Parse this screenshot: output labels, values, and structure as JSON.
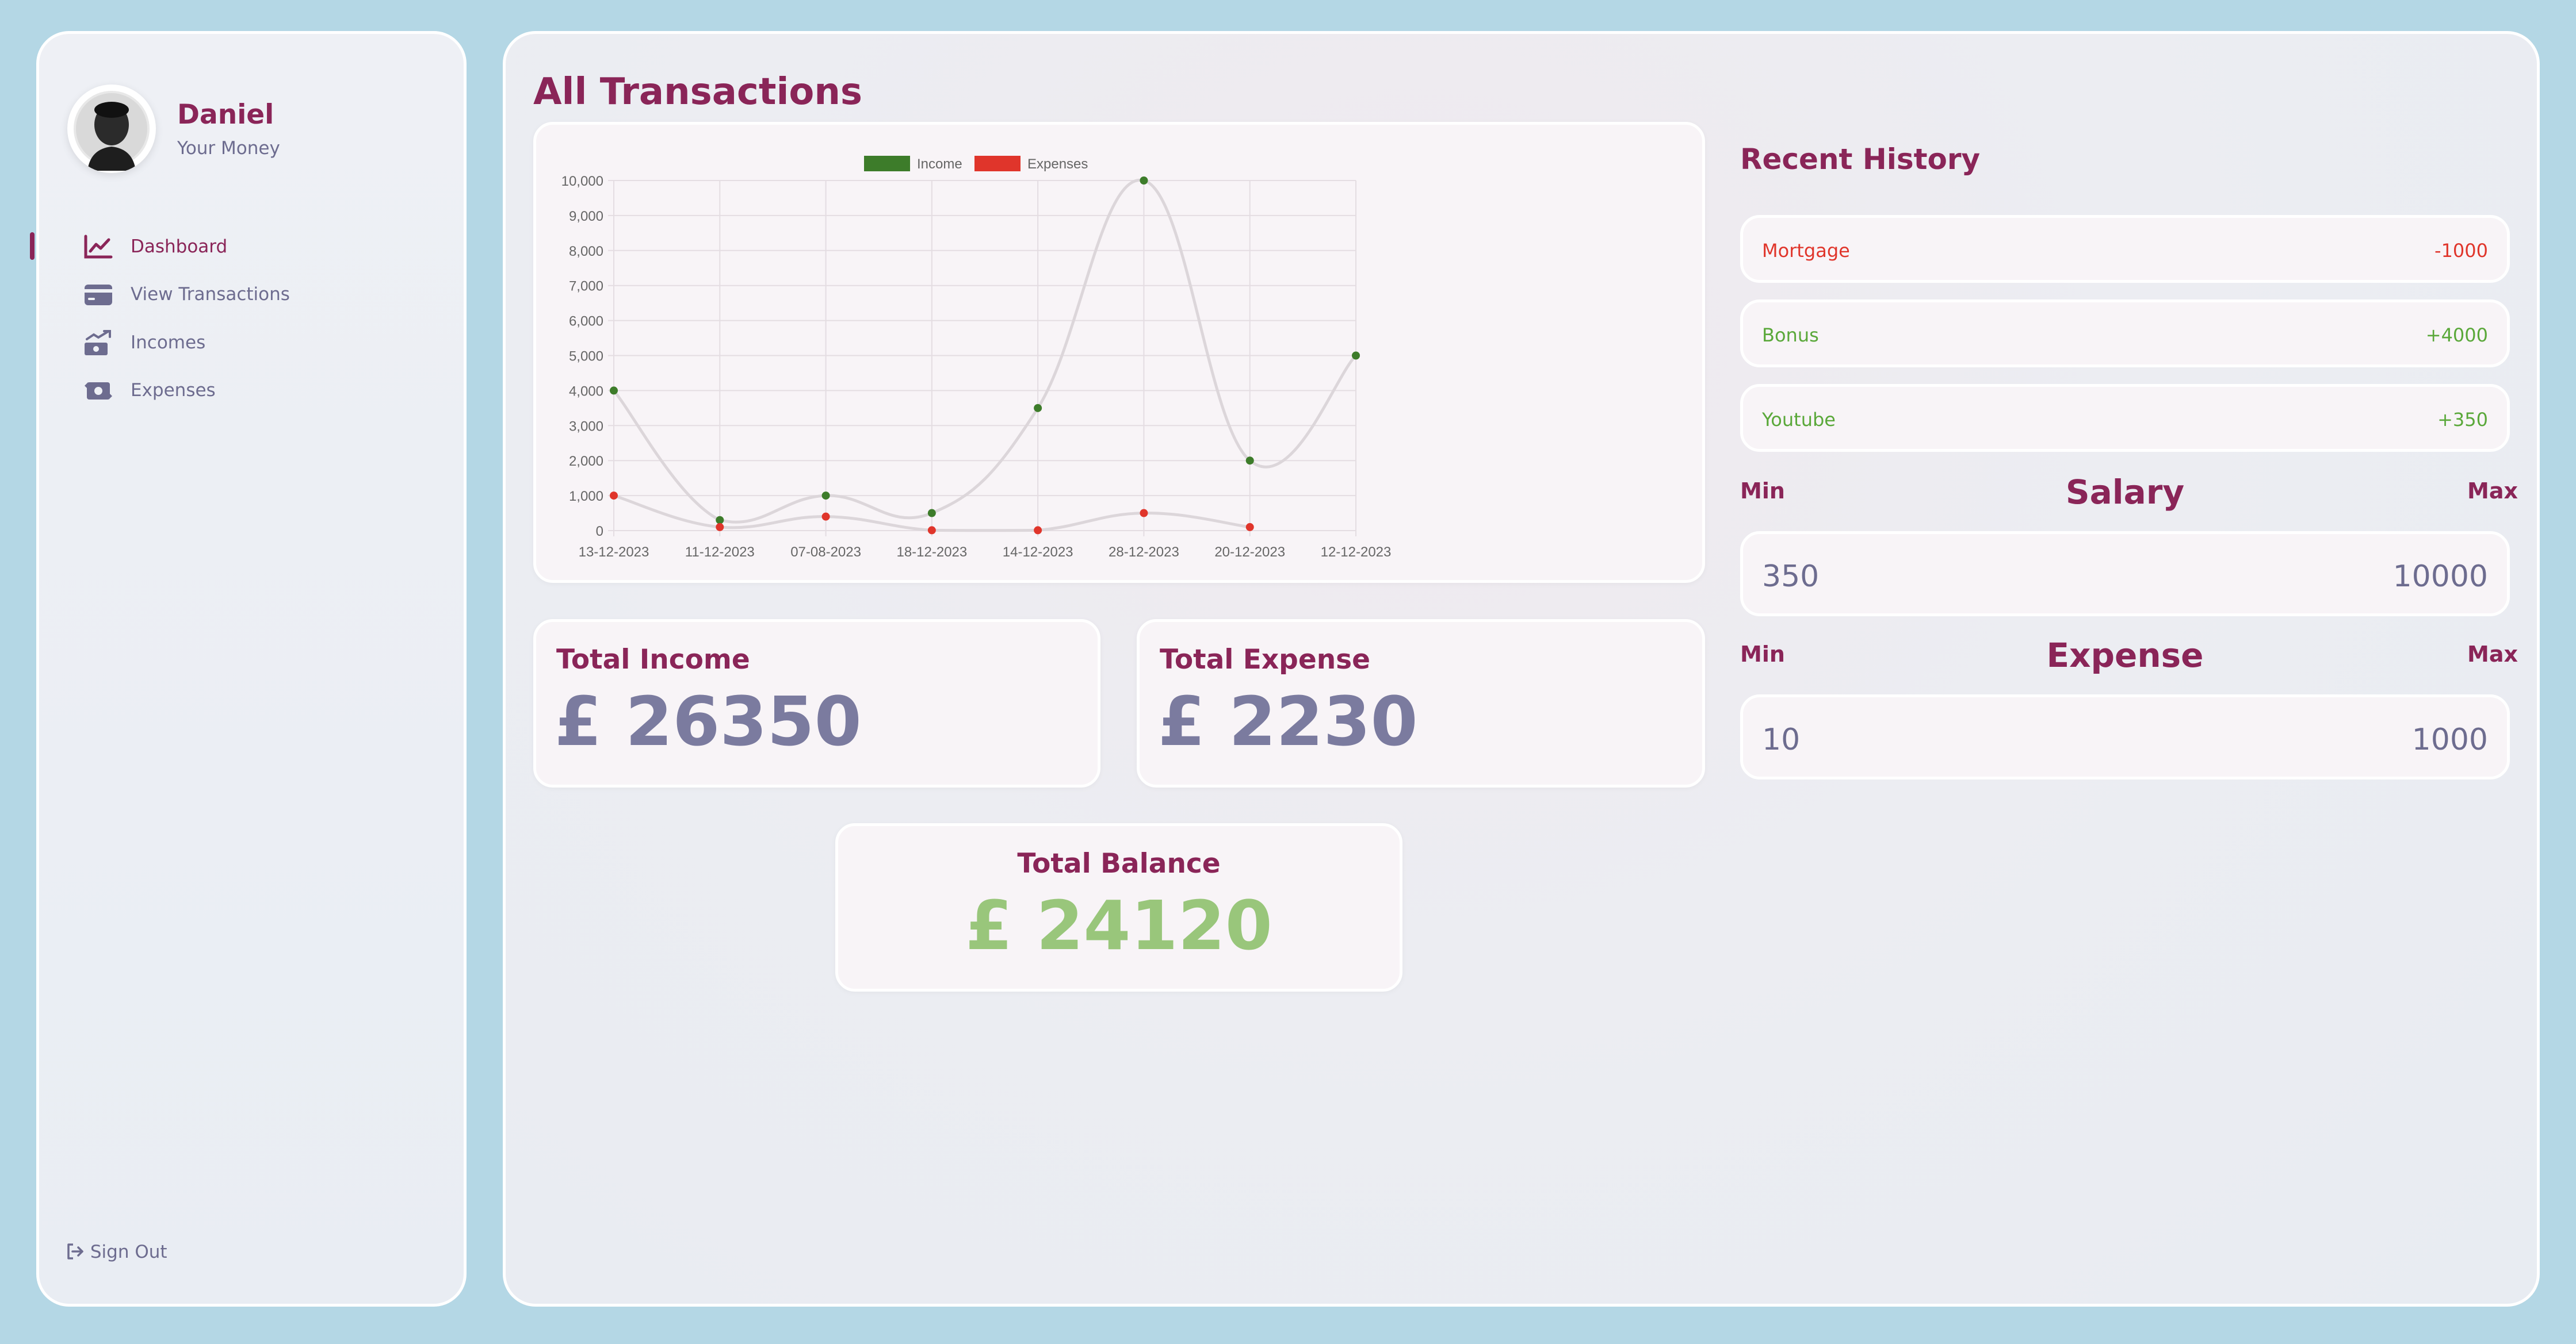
{
  "user": {
    "name": "Daniel",
    "subtitle": "Your Money"
  },
  "nav": {
    "items": [
      {
        "label": "Dashboard",
        "icon": "chart-line-icon",
        "active": true
      },
      {
        "label": "View Transactions",
        "icon": "credit-card-icon",
        "active": false
      },
      {
        "label": "Incomes",
        "icon": "money-bill-trend-up-icon",
        "active": false
      },
      {
        "label": "Expenses",
        "icon": "money-bill-transfer-icon",
        "active": false
      }
    ],
    "sign_out": "Sign Out"
  },
  "main": {
    "title": "All Transactions"
  },
  "totals": {
    "income_label": "Total Income",
    "income_value": "£ 26350",
    "expense_label": "Total Expense",
    "expense_value": "£ 2230",
    "balance_label": "Total Balance",
    "balance_value": "£ 24120"
  },
  "history": {
    "title": "Recent History",
    "items": [
      {
        "name": "Mortgage",
        "amount": "-1000",
        "type": "expense"
      },
      {
        "name": "Bonus",
        "amount": "+4000",
        "type": "income"
      },
      {
        "name": "Youtube",
        "amount": "+350",
        "type": "income"
      }
    ]
  },
  "ranges": {
    "min_label": "Min",
    "max_label": "Max",
    "salary": {
      "title": "Salary",
      "min": "350",
      "max": "10000"
    },
    "expense": {
      "title": "Expense",
      "min": "10",
      "max": "1000"
    }
  },
  "colors": {
    "accent": "#8a2558",
    "muted": "#6d6c8f",
    "income": "#3d7c2a",
    "expense": "#e0352b",
    "history_income": "#5aa83a",
    "history_expense": "#e0352b",
    "balance": "#99c67b"
  },
  "chart_data": {
    "type": "line",
    "categories": [
      "13-12-2023",
      "11-12-2023",
      "07-08-2023",
      "18-12-2023",
      "14-12-2023",
      "28-12-2023",
      "20-12-2023",
      "12-12-2023"
    ],
    "series": [
      {
        "name": "Income",
        "values": [
          4000,
          300,
          1000,
          500,
          3500,
          10000,
          2000,
          5000
        ]
      },
      {
        "name": "Expenses",
        "values": [
          1000,
          100,
          400,
          10,
          10,
          500,
          100,
          null
        ]
      }
    ],
    "ylim": [
      0,
      10000
    ],
    "yticks": [
      "10,000",
      "9,000",
      "8,000",
      "7,000",
      "6,000",
      "5,000",
      "4,000",
      "3,000",
      "2,000",
      "1,000",
      "0"
    ],
    "grid": true,
    "legend": "top"
  }
}
